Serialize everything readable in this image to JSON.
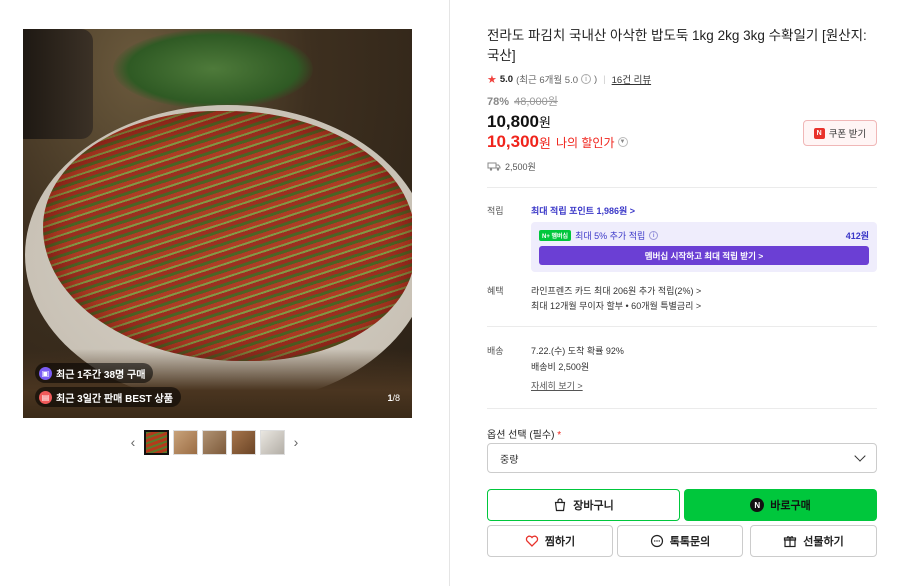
{
  "gallery": {
    "badge_weekly": "최근 1주간 38명 구매",
    "badge_best": "최근 3일간 판매 BEST 상품",
    "counter_current": "1",
    "counter_total": "/8"
  },
  "product": {
    "title": "전라도 파김치 국내산 아삭한 밥도둑 1kg 2kg 3kg 수확일기 [원산지: 국산]",
    "rating": "5.0",
    "rating_note": "(최근 6개월 5.0",
    "review_link": "16건 리뷰",
    "discount_pct": "78%",
    "original_price": "48,000원",
    "price": "10,800",
    "price_unit": "원",
    "my_price": "10,300",
    "my_price_unit": "원",
    "my_price_label": "나의 할인가",
    "shipping_fee": "2,500원",
    "coupon_label": "쿠폰 받기"
  },
  "points": {
    "label": "적립",
    "max_points_link": "최대 적립 포인트 1,986원 >",
    "member_tag": "N+ 멤버십",
    "member_extra": "최대 5% 추가 적립",
    "member_amount": "412원",
    "member_cta": "멤버십 시작하고 최대 적립 받기 >"
  },
  "benefits": {
    "label": "혜택",
    "line1": "라인프렌즈 카드 최대 206원 추가 적립(2%) >",
    "line2": "최대 12개월 무이자 할부 • 60개월 특별금리 >"
  },
  "delivery": {
    "label": "배송",
    "arrival": "7.22.(수) 도착 확률 92%",
    "fee": "배송비 2,500원",
    "detail_link": "자세히 보기 >"
  },
  "options": {
    "label": "옵션 선택 (필수)",
    "required_mark": "*",
    "selected": "중량"
  },
  "actions": {
    "cart": "장바구니",
    "buy": "바로구매",
    "wish": "찜하기",
    "talk": "톡톡문의",
    "gift": "선물하기"
  }
}
